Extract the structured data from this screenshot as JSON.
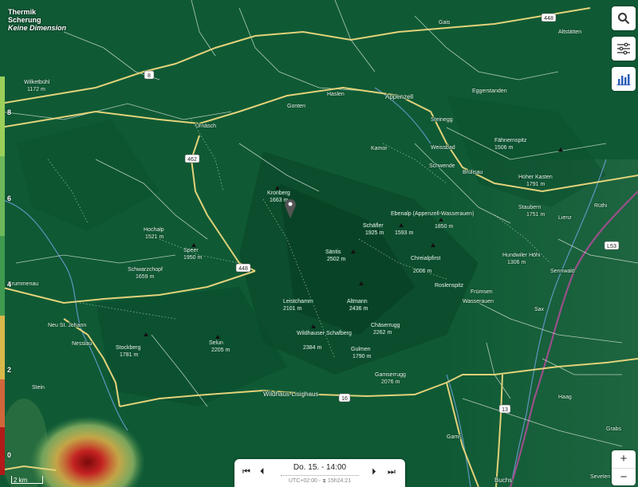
{
  "layer": {
    "line1": "Thermik",
    "line2": "Scherung",
    "line3": "Keine Dimension"
  },
  "legend": {
    "ticks": [
      "8",
      "6",
      "4",
      "2",
      "0"
    ]
  },
  "roads": {
    "r448a": "448",
    "r8": "8",
    "r462": "462",
    "r448b": "448",
    "r16": "16",
    "r13": "13",
    "l53": "L53"
  },
  "places": {
    "appenzell": "Appenzell",
    "wildhaus": "Wildhaus-Lisighaus",
    "buchs": "Buchs",
    "gams": "Gams",
    "nesslau": "Nesslau",
    "urnasch": "Urnäsch",
    "altstatten": "Altstätten",
    "gais": "Gais",
    "eggerstanden": "Eggerstanden",
    "haslen": "Haslen",
    "gonten": "Gonten",
    "steinegg": "Steinegg",
    "wasserauen": "Wasserauen",
    "brulisau": "Brülisau",
    "frumsen": "Frümsen",
    "sax": "Sax",
    "sennwald": "Sennwald",
    "haag": "Haag",
    "ruthi": "Rüthi",
    "lienz": "Lienz",
    "sevelen": "Sevelen",
    "grabs": "Grabs",
    "krummenau": "Krummenau",
    "stein": "Stein",
    "schwende": "Schwende",
    "weissbad": "Weissbad",
    "neu_st_johann": "Neu St. Johann"
  },
  "peaks": {
    "saentis_name": "Säntis",
    "saentis_alt": "2502 m",
    "altmann_name": "Altmann",
    "altmann_alt": "2436 m",
    "krazeren_name": "Kronberg",
    "krazeren_alt": "1663 m",
    "schafler_name": "Schäfler",
    "schafler_alt": "1925 m",
    "ebenalp_name": "Ebenalp (Appenzell-Wasserauen)",
    "ebenalp_alt": "1593 m",
    "hochalp_name": "Hochalp",
    "hochalp_alt": "1521 m",
    "speer_name": "Speer",
    "speer_alt": "1950 m",
    "stockberg_name": "Stockberg",
    "stockberg_alt": "1781 m",
    "schafberg_name": "Wildhauser Schafberg",
    "schafberg_alt": "2384 m",
    "gulmen_name": "Gulmen",
    "gulmen_alt": "1790 m",
    "hoher_kasten_name": "Hoher Kasten",
    "hoher_kasten_alt": "1791 m",
    "kamor_name": "Kamor",
    "kamor_alt": "1751 m",
    "fahnern_name": "Fähnernspitz",
    "fahnern_alt": "1506 m",
    "hundwiler_name": "Hundwiler Höhi",
    "hundwiler_alt": "1306 m",
    "gamsberg_name": "Gamserrugg",
    "gamsberg_alt": "2076 m",
    "chaeserrugg_name": "Chäserrugg",
    "chaeserrugg_alt": "2262 m",
    "leistchamm_name": "Leistchamm",
    "leistchamm_alt": "2101 m",
    "schwarzchopf_name": "Schwarzchopf",
    "schwarzchopf_alt": "1659 m",
    "selun_name": "Selun",
    "selun_alt": "2205 m",
    "wilketbuehl_name": "Wilketbühl",
    "wilketbuehl_alt": "1172 m",
    "staubern_name": "Staubern",
    "staubern_alt": "1751 m",
    "roslenspitz_name": "Roslenspitz",
    "roslenspitz_alt": "1850 m",
    "chreialpfirst_name": "Chreialpfirst",
    "chreialpfirst_alt": "2006 m"
  },
  "scale": {
    "label": "2 km"
  },
  "timebar": {
    "date": "Do. 15. - 14:00",
    "utc": "UTC+02:00 - ⧗ 15h24:21"
  },
  "controls": [
    "search-icon",
    "sliders-icon",
    "chart-icon"
  ],
  "colors": {
    "map_base": "#0f5a35",
    "ridge_shadow": "#083f24",
    "hotspot_red": "#b21a1a",
    "hotspot_yellow": "#e6d25a",
    "road_yellow": "#e3d27a",
    "river_blue": "#6e9ed6",
    "rail_purple": "#9a4f8a",
    "accent_blue": "#2b5fb8"
  },
  "zoom": {
    "in": "+",
    "out": "−"
  }
}
